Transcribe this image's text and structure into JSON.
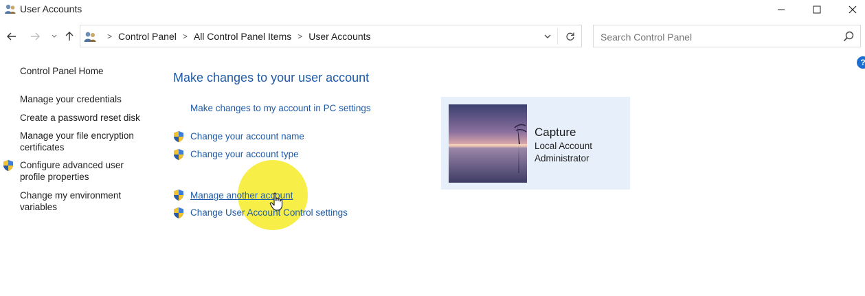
{
  "window": {
    "title": "User Accounts"
  },
  "nav": {
    "breadcrumb": [
      "Control Panel",
      "All Control Panel Items",
      "User Accounts"
    ],
    "search_placeholder": "Search Control Panel",
    "help_label": "?"
  },
  "left_pane": {
    "home": "Control Panel Home",
    "items": [
      "Manage your credentials",
      "Create a password reset disk",
      "Manage your file encryption certificates",
      "Configure advanced user profile properties",
      "Change my environment variables"
    ]
  },
  "main": {
    "heading": "Make changes to your user account",
    "pc_settings_link": "Make changes to my account in PC settings",
    "tasks": [
      "Change your account name",
      "Change your account type",
      "Manage another account",
      "Change User Account Control settings"
    ]
  },
  "account": {
    "name": "Capture",
    "type": "Local Account",
    "role": "Administrator"
  },
  "colors": {
    "link": "#1e5aa8",
    "tile_background": "#e7f0fa",
    "cursor_highlight": "#f5eb1e"
  }
}
